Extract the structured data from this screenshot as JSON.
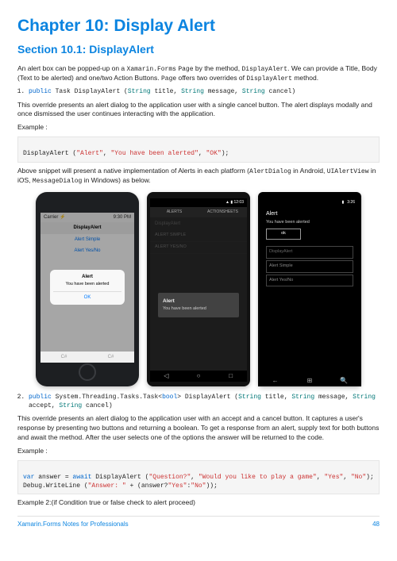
{
  "chapter_title": "Chapter 10: Display Alert",
  "section_title": "Section 10.1: DisplayAlert",
  "intro": {
    "pre1": "An alert box can be popped-up on a ",
    "code1": "Xamarin.Forms",
    "mid1": " ",
    "code2": "Page",
    "mid2": " by the method, ",
    "code3": "DisplayAlert",
    "mid3": ". We can provide a Title, Body (Text to be alerted) and one/two Action Buttons. ",
    "code4": "Page",
    "mid4": " offers two overrides of ",
    "code5": "DisplayAlert",
    "post": " method."
  },
  "sig1": {
    "kw_public": "public",
    "ret_task": "Task",
    "name": "DisplayAlert",
    "lp": " (",
    "t_string": "String",
    "p_title": " title, ",
    "p_msg": " message, ",
    "p_cancel": " cancel",
    "rp": ")"
  },
  "para_after_sig1": "This override presents an alert dialog to the application user with a single cancel button. The alert displays modally and once dismissed the user continues interacting with the application.",
  "example_label": "Example :",
  "code_ex1": {
    "call": "DisplayAlert ",
    "lp": "(",
    "s1": "\"Alert\"",
    "c1": ", ",
    "s2": "\"You have been alerted\"",
    "c2": ", ",
    "s3": "\"OK\"",
    "rp": ");"
  },
  "para_after_ex1_a": "Above snippet will present a native implementation of Alerts in each platform (",
  "para_after_ex1_code1": "AlertDialog",
  "para_after_ex1_b": " in Android, ",
  "para_after_ex1_code2": "UIAlertView",
  "para_after_ex1_c": " in iOS, ",
  "para_after_ex1_code3": "MessageDialog",
  "para_after_ex1_d": " in Windows) as below.",
  "ios": {
    "carrier": "Carrier ⚡",
    "time": "9:30 PM",
    "nav_title": "DisplayAlert",
    "btn1": "Alert Simple",
    "btn2": "Alert Yes/No",
    "alert_title": "Alert",
    "alert_body": "You have been alerted",
    "alert_ok": "OK",
    "back": "C#",
    "fwd": "C#"
  },
  "android": {
    "time": "▲ ▮ 12:03",
    "tab1": "ALERTS",
    "tab2": "ACTIONSHEETS",
    "screen_title": "DisplayAlert",
    "btn1": "ALERT SIMPLE",
    "btn2": "ALERT YES/NO",
    "alert_title": "Alert",
    "alert_body": "You have been alerted"
  },
  "windows": {
    "time": "3:26",
    "title": "Alert",
    "body": "You have been alerted",
    "ok": "ok",
    "header": "DisplayAlert",
    "item1": "Alert Simple",
    "item2": "Alert Yes/No"
  },
  "sig2": {
    "kw_public": "public",
    "ns_prefix": "System.Threading.Tasks.",
    "task": "Task",
    "lt": "<",
    "bool": "bool",
    "gt": "> ",
    "name": "DisplayAlert ",
    "lp": "(",
    "t_string": "String",
    "p_title": " title, ",
    "p_msg": " message, ",
    "p_accept": " accept, ",
    "p_cancel": " cancel",
    "rp": ")"
  },
  "para_after_sig2": "This override presents an alert dialog to the application user with an accept and a cancel button. It captures a user's response by presenting two buttons and returning a boolean. To get a response from an alert, supply text for both buttons and await the method. After the user selects one of the options the answer will be returned to the code.",
  "code_ex2": {
    "l1_var": "var",
    "l1_a": " answer = ",
    "l1_await": "await",
    "l1_b": " DisplayAlert ",
    "l1_lp": "(",
    "l1_s1": "\"Question?\"",
    "l1_c1": ", ",
    "l1_s2": "\"Would you like to play a game\"",
    "l1_c2": ", ",
    "l1_s3": "\"Yes\"",
    "l1_c3": ", ",
    "l1_s4": "\"No\"",
    "l1_rp": ");",
    "l2_a": "Debug.WriteLine ",
    "l2_lp": "(",
    "l2_s1": "\"Answer: \"",
    "l2_b": " + (answer?",
    "l2_s2": "\"Yes\"",
    "l2_c": ":",
    "l2_s3": "\"No\"",
    "l2_rp": "));"
  },
  "example2_label": "Example 2:(if Condition true or false check to alert proceed)",
  "footer_left": "Xamarin.Forms Notes for Professionals",
  "footer_right": "48"
}
